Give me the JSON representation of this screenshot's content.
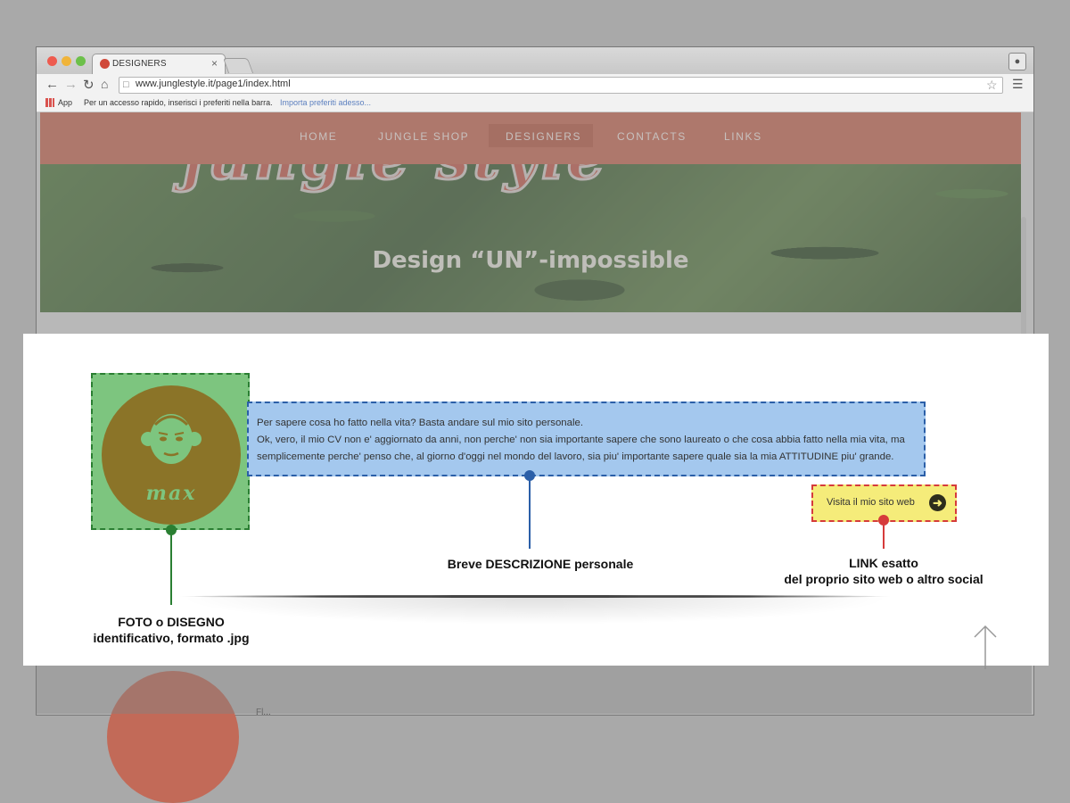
{
  "browser": {
    "tab_title": "DESIGNERS",
    "tab_close": "×",
    "url": "www.junglestyle.it/page1/index.html",
    "bookmarks": {
      "apps_label": "App",
      "hint": "Per un accesso rapido, inserisci i preferiti nella barra.",
      "import_link": "Importa preferiti adesso..."
    }
  },
  "site": {
    "logo_text": "jungle style",
    "nav": [
      {
        "label": "HOME"
      },
      {
        "label": "JUNGLE SHOP"
      },
      {
        "label": "DESIGNERS"
      },
      {
        "label": "CONTACTS"
      },
      {
        "label": "LINKS"
      }
    ],
    "active_nav": "DESIGNERS",
    "hero_title": "Design “UN”-impossible"
  },
  "designer": {
    "avatar_name": "max",
    "description_lines": [
      "Per sapere cosa ho fatto nella vita? Basta andare sul mio sito personale.",
      "Ok, vero, il mio CV non e' aggiornato da anni, non perche' non sia importante sapere che sono laureato o che cosa abbia fatto nella mia vita, ma semplicemente perche' penso che, al giorno d'oggi nel mondo del lavoro, sia piu' importante sapere quale sia la mia ATTITUDINE piu' grande."
    ],
    "link_label": "Visita il mio sito web"
  },
  "annotations": {
    "photo": {
      "line1": "FOTO o DISEGNO",
      "line2": "identificativo, formato .jpg",
      "color": "#2a7f32"
    },
    "description": {
      "line1": "Breve DESCRIZIONE personale",
      "color": "#2b5fa8"
    },
    "link": {
      "line1": "LINK esatto",
      "line2": "del proprio sito web o altro social",
      "color": "#d63b3b"
    }
  },
  "next_designer_text": "Fl..."
}
